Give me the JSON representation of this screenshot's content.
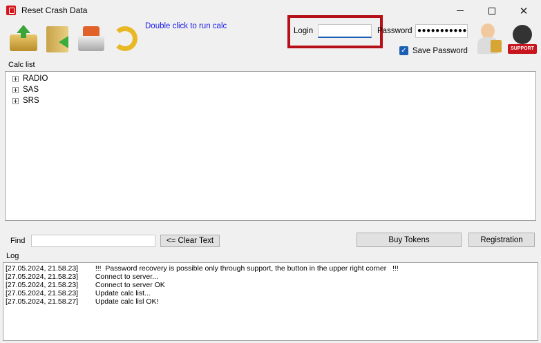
{
  "window": {
    "title": "Reset Crash Data",
    "controls": {
      "minimize": "minimize-icon",
      "maximize": "maximize-icon",
      "close": "✕"
    }
  },
  "toolbar": {
    "icons": [
      "open-folder-icon",
      "save-book-icon",
      "car-data-icon",
      "refresh-icon"
    ],
    "hint": "Double click to run calc"
  },
  "auth": {
    "login_label": "Login",
    "login_value": "",
    "password_label": "Password",
    "password_value": "●●●●●●●●●●●",
    "save_password_label": "Save Password",
    "save_password_checked": true,
    "highlight_color": "#b50f17",
    "support_label": "SUPPORT"
  },
  "calc": {
    "label": "Calc list",
    "items": [
      {
        "label": "RADIO"
      },
      {
        "label": "SAS"
      },
      {
        "label": "SRS"
      }
    ]
  },
  "find": {
    "label": "Find",
    "value": "",
    "clear_label": "<= Clear Text",
    "buy_label": "Buy Tokens",
    "registration_label": "Registration"
  },
  "log": {
    "label": "Log",
    "entries": [
      {
        "time": "[27.05.2024, 21.58.23]",
        "message": "  !!!  Password recovery is possible only through support, the button in the upper right corner   !!!"
      },
      {
        "time": "[27.05.2024, 21.58.23]",
        "message": "  Connect to server..."
      },
      {
        "time": "[27.05.2024, 21.58.23]",
        "message": "  Connect to server OK"
      },
      {
        "time": "[27.05.2024, 21.58.23]",
        "message": "  Update calc list..."
      },
      {
        "time": "[27.05.2024, 21.58.27]",
        "message": "  Update calc lisl OK!"
      }
    ]
  }
}
